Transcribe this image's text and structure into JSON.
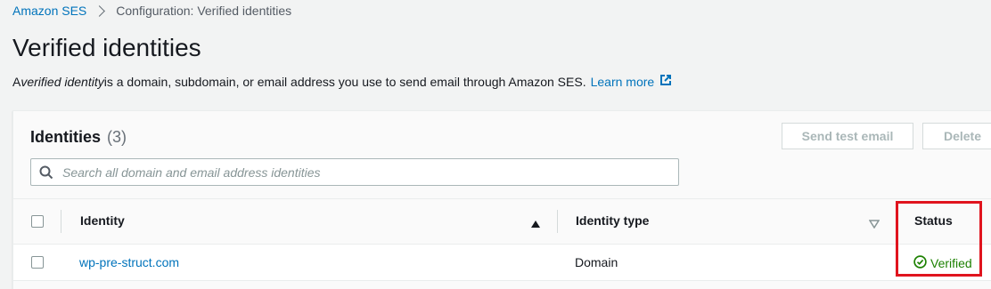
{
  "breadcrumb": {
    "root": "Amazon SES",
    "current": "Configuration: Verified identities"
  },
  "page": {
    "title": "Verified identities",
    "description_prefix": "A ",
    "description_emphasis": "verified identity",
    "description_suffix": " is a domain, subdomain, or email address you use to send email through Amazon SES.",
    "learn_more": "Learn more"
  },
  "identities_panel": {
    "title": "Identities",
    "count": "(3)",
    "send_test_email_label": "Send test email",
    "delete_label": "Delete",
    "search_placeholder": "Search all domain and email address identities"
  },
  "table": {
    "columns": [
      "Identity",
      "Identity type",
      "Status"
    ],
    "rows": [
      {
        "identity": "wp-pre-struct.com",
        "type": "Domain",
        "status": "Verified"
      }
    ]
  },
  "colors": {
    "link": "#0073bb",
    "verified": "#1d8102",
    "highlight": "#e0141e"
  }
}
